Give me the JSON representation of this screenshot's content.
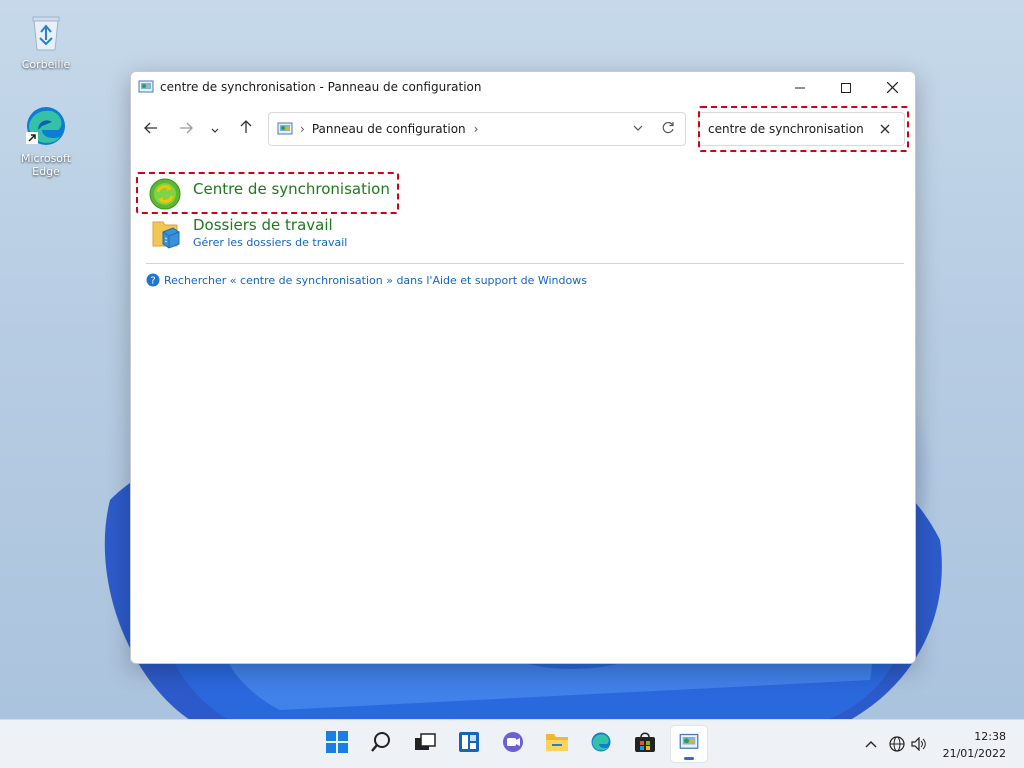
{
  "desktop": {
    "icons": [
      {
        "label": "Corbeille",
        "icon": "recycle-bin-icon"
      },
      {
        "label": "Microsoft Edge",
        "icon": "edge-icon"
      }
    ]
  },
  "window": {
    "title": "centre de synchronisation - Panneau de configuration",
    "controls": [
      "minimize-icon",
      "maximize-icon",
      "close-icon"
    ]
  },
  "address_bar": {
    "breadcrumb": "Panneau de configuration",
    "nav": [
      "back-arrow-icon",
      "forward-arrow-icon",
      "recent-dropdown-icon",
      "up-arrow-icon"
    ]
  },
  "search": {
    "value": "centre de synchronisation"
  },
  "results": [
    {
      "title": "Centre de synchronisation",
      "subtitle": "",
      "icon": "sync-center-icon"
    },
    {
      "title": "Dossiers de travail",
      "subtitle": "Gérer les dossiers de travail",
      "icon": "work-folders-icon"
    }
  ],
  "help_link": "Rechercher « centre de synchronisation » dans l'Aide et support de Windows",
  "taskbar": {
    "apps": [
      "start-icon",
      "search-icon",
      "task-view-icon",
      "widgets-icon",
      "chat-icon",
      "file-explorer-icon",
      "edge-icon",
      "store-icon",
      "control-panel-icon"
    ],
    "time": "12:38",
    "date": "21/01/2022"
  },
  "colors": {
    "highlight": "#d0021b",
    "result_title": "#1e7a1e",
    "link": "#1565c0"
  }
}
